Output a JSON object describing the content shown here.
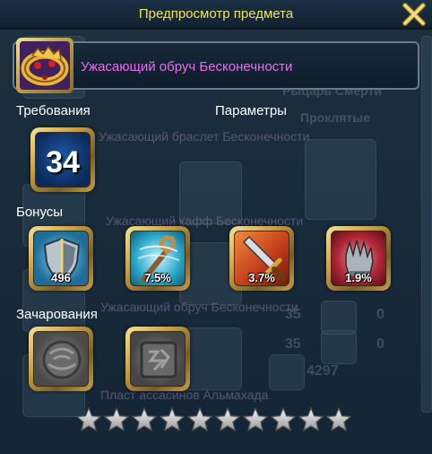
{
  "window": {
    "title": "Предпросмотр предмета"
  },
  "item": {
    "name": "Ужасающий обруч Бесконечности",
    "icon": "gold-ring-icon"
  },
  "sections": {
    "requirements": "Требования",
    "parameters": "Параметры",
    "bonuses": "Бонусы",
    "enchantments": "Зачарования"
  },
  "requirement": {
    "level": "34"
  },
  "bonuses": [
    {
      "icon": "shield-defense-icon",
      "value": "496"
    },
    {
      "icon": "staff-magic-icon",
      "value": "7.5%"
    },
    {
      "icon": "sword-attack-icon",
      "value": "3.7%"
    },
    {
      "icon": "gauntlet-icon",
      "value": "1.9%"
    }
  ],
  "enchant_slots": [
    {
      "icon": "empty-enchant-slot-icon"
    },
    {
      "icon": "empty-enchant-slot-icon"
    }
  ],
  "stars": {
    "total": 10,
    "filled": 0
  },
  "background": {
    "ghost_texts": [
      "Ужасающий браслет Бесконечности",
      "Ужасающий кафф Бесконечности",
      "Ужасающий обруч Бесконечности",
      "Пласт ассасинов Альмахада"
    ],
    "side_texts": [
      "Рыцарь Смерти",
      "Проклятые"
    ],
    "numbers": [
      "35",
      "0",
      "35",
      "0",
      "4297"
    ]
  },
  "colors": {
    "title": "#f1e25a",
    "item_name": "#e86ef0",
    "accent_gold": "#c9a04a"
  }
}
